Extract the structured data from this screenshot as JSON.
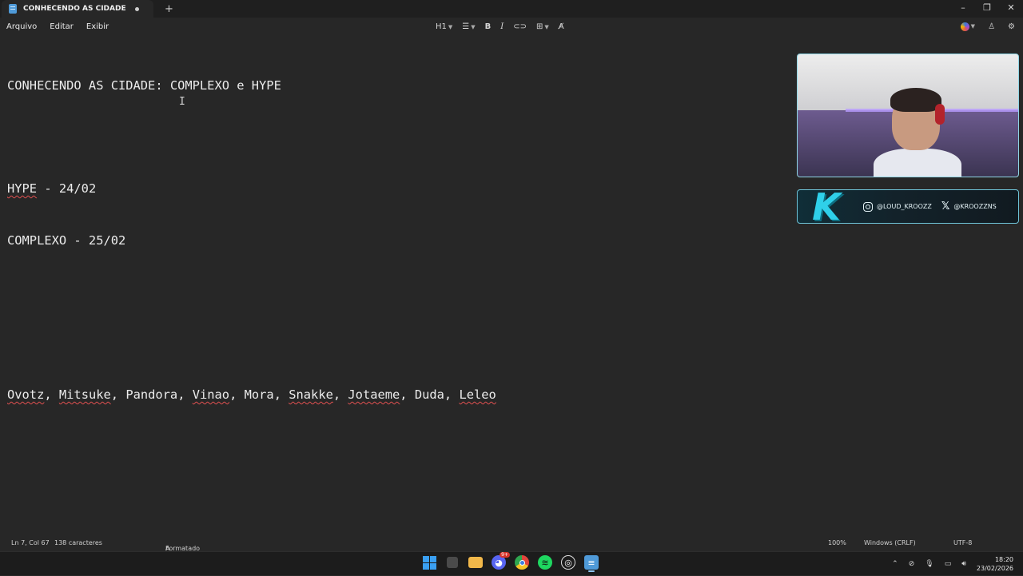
{
  "tab": {
    "title": "CONHECENDO AS CIDADE COMPLI"
  },
  "menu": {
    "file": "Arquivo",
    "edit": "Editar",
    "view": "Exibir"
  },
  "toolbar": {
    "heading": "H1"
  },
  "editor": {
    "line1": "CONHECENDO AS CIDADE: COMPLEXO e HYPE",
    "line3_a": "HYPE",
    "line3_b": " - 24/02",
    "line4": "COMPLEXO - 25/02",
    "names": [
      "Ovotz",
      "Mitsuke",
      "Pandora",
      "Vinao",
      "Mora",
      "Snakke",
      "Jotaeme",
      "Duda",
      "Leleo"
    ],
    "sep": ", "
  },
  "overlay": {
    "logo": "K",
    "instagram": "@LOUD_KROOZZ",
    "twitter": "@KROOZZNS"
  },
  "status": {
    "position": "Ln 7, Col 67",
    "chars": "138 caracteres",
    "format": "Formatado",
    "zoom": "100%",
    "line_ending": "Windows (CRLF)",
    "encoding": "UTF-8"
  },
  "taskbar": {
    "discord_badge": "9+",
    "time": "18:20",
    "date": "23/02/2026"
  },
  "colors": {
    "accent": "#2fd0ea",
    "squiggle": "#e05050",
    "background": "#272727"
  }
}
